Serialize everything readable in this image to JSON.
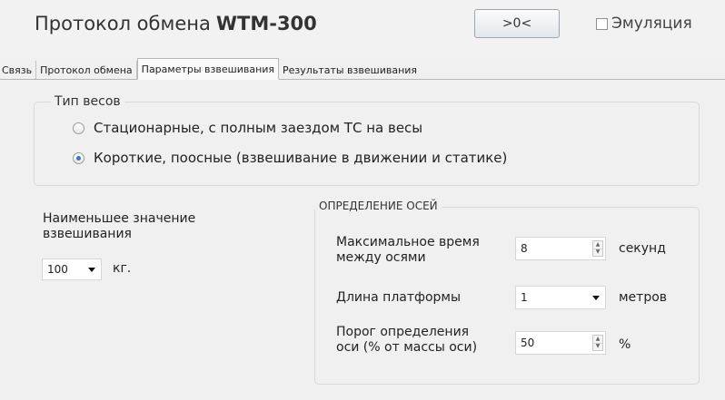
{
  "header": {
    "title": "Протокол обмена",
    "model": "WTM-300",
    "zero_button": ">0<",
    "emulation_label": "Эмуляция",
    "emulation_checked": false
  },
  "tabs": [
    {
      "label": "Связь",
      "active": false
    },
    {
      "label": "Протокол обмена",
      "active": false
    },
    {
      "label": "Параметры взвешивания",
      "active": true
    },
    {
      "label": "Результаты взвешивания",
      "active": false
    }
  ],
  "scale_type": {
    "title": "Тип весов",
    "options": [
      {
        "label": "Стационарные, с полным заездом ТС на весы",
        "checked": false
      },
      {
        "label": "Короткие, поосные (взвешивание в движении и статике)",
        "checked": true
      }
    ]
  },
  "min_weight": {
    "label_line1": "Наименьшее значение",
    "label_line2": "взвешивания",
    "value": "100",
    "unit": "кг."
  },
  "axis_detection": {
    "title": "ОПРЕДЕЛЕНИЕ ОСЕЙ",
    "max_time": {
      "label_line1": "Максимальное время",
      "label_line2": "между осями",
      "value": "8",
      "unit": "секунд"
    },
    "platform_length": {
      "label": "Длина платформы",
      "value": "1",
      "unit": "метров"
    },
    "threshold": {
      "label_line1": "Порог определения",
      "label_line2": "оси (% от массы оси)",
      "value": "50",
      "unit": "%"
    }
  }
}
